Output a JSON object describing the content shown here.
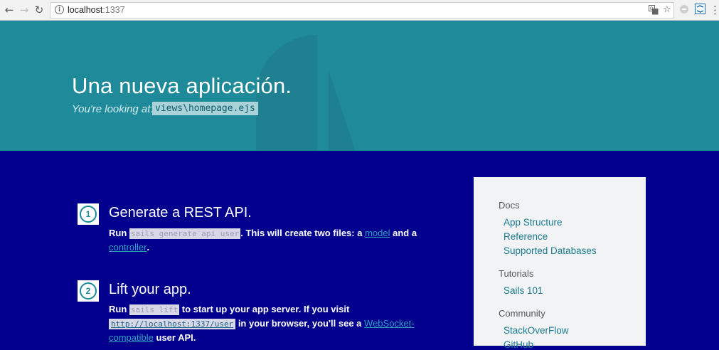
{
  "browser": {
    "url_host": "localhost",
    "url_port": ":1337"
  },
  "hero": {
    "title": "Una nueva aplicación.",
    "subtitle": "You're looking at:",
    "file": "views\\homepage.ejs"
  },
  "steps": [
    {
      "number": "1",
      "title": "Generate a REST API.",
      "text_run": "Run",
      "code": "sails generate api user",
      "text_mid": ". This will create two files: a",
      "link_model": "model",
      "text_and": "and a",
      "link_controller": "controller",
      "text_end": "."
    },
    {
      "number": "2",
      "title": "Lift your app.",
      "text_run": "Run",
      "code": "sails lift",
      "text_mid": "to start up your app server. If you visit",
      "url": "http://localhost:1337/user",
      "text_browser": "in your browser, you'll see a",
      "link_websocket": "WebSocket-compatible",
      "text_end": "user API."
    }
  ],
  "sidebar": {
    "docs_heading": "Docs",
    "docs_links": [
      "App Structure",
      "Reference",
      "Supported Databases"
    ],
    "tutorials_heading": "Tutorials",
    "tutorials_links": [
      "Sails 101"
    ],
    "community_heading": "Community",
    "community_links": [
      "StackOverFlow",
      "GitHub"
    ]
  },
  "colors": {
    "hero_bg": "#1f8a99",
    "main_bg": "#02008d",
    "sidebar_bg": "#f1f3f4",
    "link": "#1b7a90"
  }
}
